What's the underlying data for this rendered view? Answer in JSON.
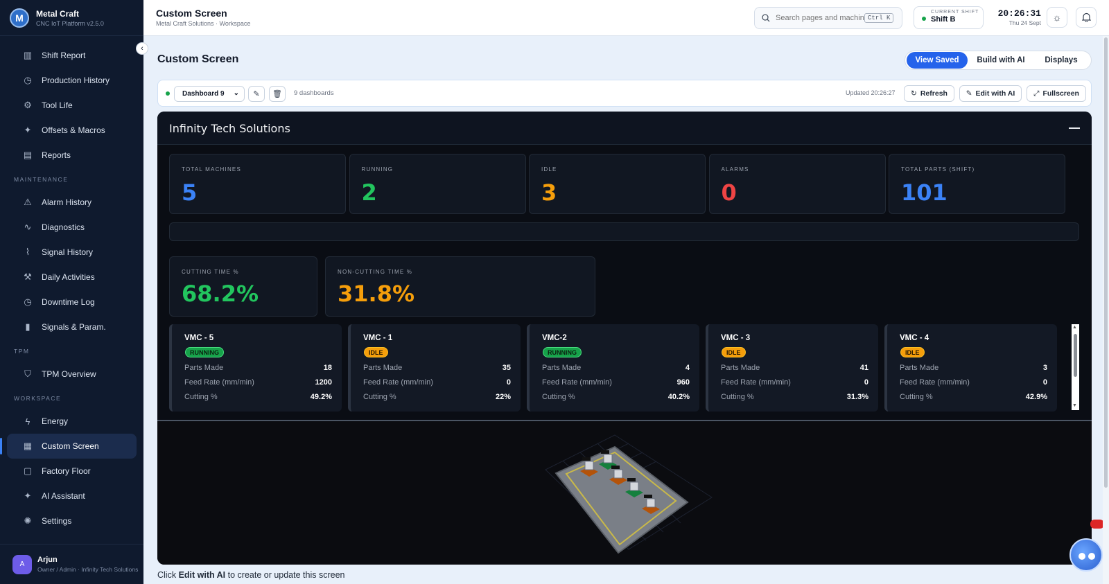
{
  "brand": {
    "name": "Metal Craft",
    "subtitle": "CNC IoT Platform v2.5.0",
    "logo_letter": "M"
  },
  "sidebar": {
    "top_items": [
      {
        "label": "Shift Report",
        "icon": "bar-chart-icon"
      },
      {
        "label": "Production History",
        "icon": "clock-icon"
      },
      {
        "label": "Tool Life",
        "icon": "gear-icon"
      },
      {
        "label": "Offsets & Macros",
        "icon": "sparkle-icon"
      },
      {
        "label": "Reports",
        "icon": "document-icon"
      }
    ],
    "sections": [
      {
        "title": "MAINTENANCE",
        "items": [
          {
            "label": "Alarm History",
            "icon": "warning-icon"
          },
          {
            "label": "Diagnostics",
            "icon": "pulse-icon"
          },
          {
            "label": "Signal History",
            "icon": "signal-icon"
          },
          {
            "label": "Daily Activities",
            "icon": "wrench-icon"
          },
          {
            "label": "Downtime Log",
            "icon": "clock-icon"
          },
          {
            "label": "Signals & Param.",
            "icon": "bars-icon"
          }
        ]
      },
      {
        "title": "TPM",
        "items": [
          {
            "label": "TPM Overview",
            "icon": "shield-icon"
          }
        ]
      },
      {
        "title": "WORKSPACE",
        "items": [
          {
            "label": "Energy",
            "icon": "lightning-icon"
          },
          {
            "label": "Custom Screen",
            "icon": "grid-icon",
            "active": true
          },
          {
            "label": "Factory Floor",
            "icon": "square-icon"
          },
          {
            "label": "AI Assistant",
            "icon": "sparkle-icon"
          },
          {
            "label": "Settings",
            "icon": "settings-icon"
          }
        ]
      }
    ]
  },
  "user": {
    "initial": "A",
    "name": "Arjun",
    "role": "Owner / Admin · Infinity Tech Solutions"
  },
  "topbar": {
    "title": "Custom Screen",
    "breadcrumb": "Metal Craft Solutions · Workspace",
    "search_placeholder": "Search pages and machines...",
    "search_shortcut": "Ctrl K",
    "shift_label": "CURRENT SHIFT",
    "shift_value": "Shift B",
    "time": "20:26:31",
    "date": "Thu 24 Sept"
  },
  "main": {
    "title": "Custom Screen",
    "tabs": [
      {
        "label": "View Saved",
        "active": true
      },
      {
        "label": "Build with AI",
        "active": false
      },
      {
        "label": "Displays",
        "active": false
      }
    ]
  },
  "toolbar": {
    "selected_dashboard": "Dashboard 9",
    "dashboard_count": "9 dashboards",
    "updated": "Updated 20:26:27",
    "refresh_label": "Refresh",
    "edit_label": "Edit with AI",
    "fullscreen_label": "Fullscreen"
  },
  "dashboard": {
    "title": "Infinity Tech Solutions",
    "kpis": [
      {
        "label": "TOTAL MACHINES",
        "value": "5",
        "color": "#3b82f6"
      },
      {
        "label": "RUNNING",
        "value": "2",
        "color": "#22c55e"
      },
      {
        "label": "IDLE",
        "value": "3",
        "color": "#f59e0b"
      },
      {
        "label": "ALARMS",
        "value": "0",
        "color": "#ef4444"
      },
      {
        "label": "TOTAL PARTS (SHIFT)",
        "value": "101",
        "color": "#3b82f6"
      }
    ],
    "cutting": [
      {
        "label": "CUTTING TIME %",
        "value": "68.2%",
        "color": "#22c55e"
      },
      {
        "label": "NON-CUTTING TIME %",
        "value": "31.8%",
        "color": "#f59e0b"
      }
    ],
    "row_labels": {
      "parts": "Parts Made",
      "feed": "Feed Rate (mm/min)",
      "cutting": "Cutting %"
    },
    "machines": [
      {
        "name": "VMC - 5",
        "status": "RUNNING",
        "parts": "18",
        "feed": "1200",
        "cutting": "49.2%"
      },
      {
        "name": "VMC - 1",
        "status": "IDLE",
        "parts": "35",
        "feed": "0",
        "cutting": "22%"
      },
      {
        "name": "VMC-2",
        "status": "RUNNING",
        "parts": "4",
        "feed": "960",
        "cutting": "40.2%"
      },
      {
        "name": "VMC - 3",
        "status": "IDLE",
        "parts": "41",
        "feed": "0",
        "cutting": "31.3%"
      },
      {
        "name": "VMC - 4",
        "status": "IDLE",
        "parts": "3",
        "feed": "0",
        "cutting": "42.9%"
      }
    ],
    "floor_machine_statuses": [
      "IDLE",
      "RUNNING",
      "IDLE",
      "RUNNING",
      "IDLE"
    ]
  },
  "hint": {
    "prefix": "Click ",
    "bold": "Edit with AI",
    "suffix": " to create or update this screen"
  }
}
